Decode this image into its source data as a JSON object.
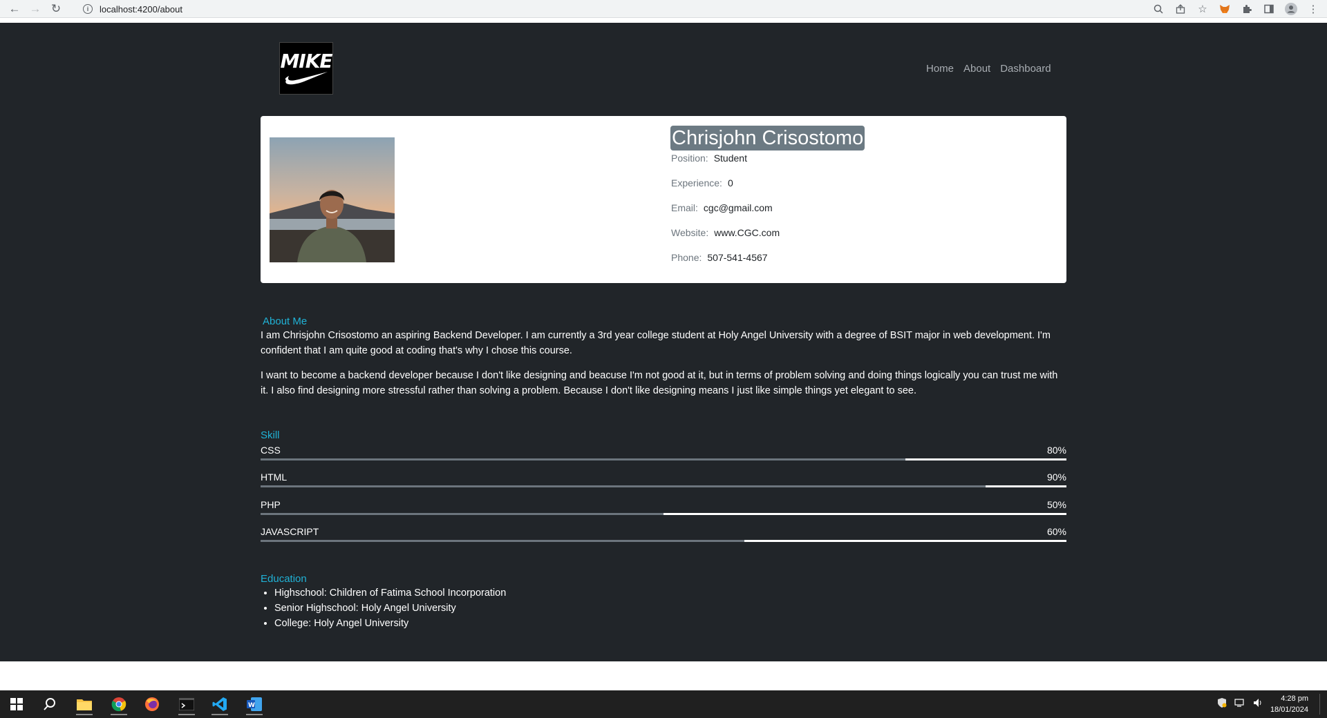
{
  "browser": {
    "url": "localhost:4200/about"
  },
  "logo": {
    "text": "MIKE"
  },
  "nav": {
    "home": "Home",
    "about": "About",
    "dashboard": "Dashboard"
  },
  "profile": {
    "name": "Chrisjohn Crisostomo",
    "fields": [
      {
        "label": "Position:",
        "value": "Student"
      },
      {
        "label": "Experience:",
        "value": "0"
      },
      {
        "label": "Email:",
        "value": "cgc@gmail.com"
      },
      {
        "label": "Website:",
        "value": "www.CGC.com"
      },
      {
        "label": "Phone:",
        "value": "507-541-4567"
      }
    ]
  },
  "about": {
    "title": "About Me",
    "p1": "I am Chrisjohn Crisostomo an aspiring Backend Developer. I am currently a 3rd year college student at Holy Angel University with a degree of BSIT major in web development. I'm confident that I am quite good at coding that's why I chose this course.",
    "p2": "I want to become a backend developer because I don't like designing and beacuse I'm not good at it, but in terms of problem solving and doing things logically you can trust me with it. I also find designing more stressful rather than solving a problem. Because I don't like designing means I just like simple things yet elegant to see."
  },
  "skills": {
    "title": "Skill",
    "items": [
      {
        "name": "CSS",
        "percent_label": "80%",
        "level": 0.8
      },
      {
        "name": "HTML",
        "percent_label": "90%",
        "level": 0.9
      },
      {
        "name": "PHP",
        "percent_label": "50%",
        "level": 0.5
      },
      {
        "name": "JAVASCRIPT",
        "percent_label": "60%",
        "level": 0.6
      }
    ]
  },
  "education": {
    "title": "Education",
    "items": [
      "Highschool: Children of Fatima School Incorporation",
      "Senior Highschool: Holy Angel University",
      "College: Holy Angel University"
    ]
  },
  "taskbar": {
    "time": "4:28 pm",
    "date": "18/01/2024"
  }
}
